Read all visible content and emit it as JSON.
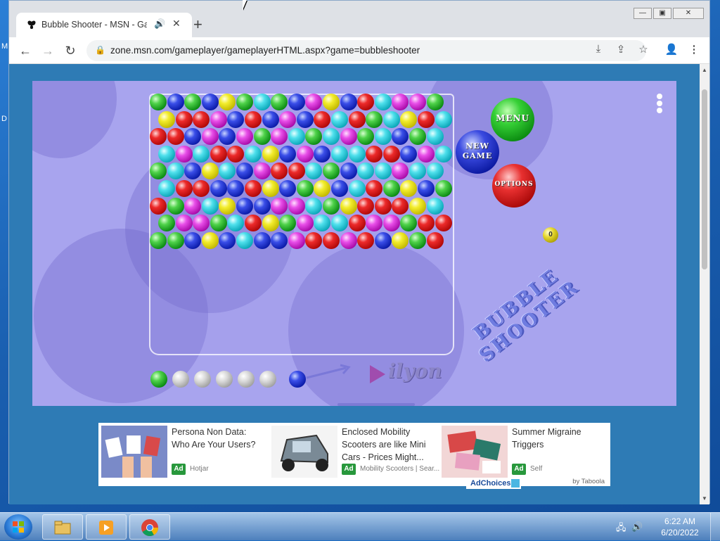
{
  "desktop": {
    "edge_letters": [
      "M",
      "D"
    ]
  },
  "browser": {
    "tab_title": "Bubble Shooter - MSN - Games",
    "url": "zone.msn.com/gameplayer/gameplayerHTML.aspx?game=bubbleshooter"
  },
  "game": {
    "menu_label": "MENU",
    "new_game_label": "NEW GAME",
    "options_label": "OPTIONS",
    "score": "0",
    "title_line1": "BUBBLE",
    "title_line2": "SHOOTER",
    "brand": "ilyon",
    "rows": [
      [
        "green",
        "blue",
        "green",
        "blue",
        "yellow",
        "green",
        "cyan",
        "green",
        "blue",
        "magenta",
        "yellow",
        "blue",
        "red",
        "cyan",
        "magenta",
        "magenta",
        "green"
      ],
      [
        "yellow",
        "red",
        "red",
        "magenta",
        "blue",
        "red",
        "blue",
        "magenta",
        "blue",
        "red",
        "cyan",
        "red",
        "green",
        "cyan",
        "yellow",
        "red",
        "cyan"
      ],
      [
        "red",
        "red",
        "blue",
        "magenta",
        "blue",
        "magenta",
        "green",
        "magenta",
        "cyan",
        "green",
        "cyan",
        "magenta",
        "green",
        "cyan",
        "blue",
        "green",
        "cyan"
      ],
      [
        "cyan",
        "magenta",
        "cyan",
        "red",
        "red",
        "cyan",
        "yellow",
        "blue",
        "magenta",
        "blue",
        "cyan",
        "cyan",
        "red",
        "red",
        "blue",
        "magenta",
        "cyan"
      ],
      [
        "green",
        "cyan",
        "blue",
        "yellow",
        "cyan",
        "blue",
        "magenta",
        "red",
        "red",
        "cyan",
        "green",
        "blue",
        "cyan",
        "cyan",
        "magenta",
        "cyan",
        "cyan"
      ],
      [
        "cyan",
        "red",
        "red",
        "blue",
        "blue",
        "red",
        "yellow",
        "blue",
        "green",
        "yellow",
        "blue",
        "cyan",
        "red",
        "green",
        "yellow",
        "blue",
        "green"
      ],
      [
        "red",
        "green",
        "magenta",
        "cyan",
        "yellow",
        "blue",
        "blue",
        "magenta",
        "magenta",
        "cyan",
        "green",
        "yellow",
        "red",
        "red",
        "red",
        "yellow",
        "cyan"
      ],
      [
        "green",
        "magenta",
        "magenta",
        "green",
        "cyan",
        "red",
        "yellow",
        "green",
        "magenta",
        "cyan",
        "cyan",
        "red",
        "magenta",
        "magenta",
        "green",
        "red",
        "red"
      ],
      [
        "green",
        "green",
        "blue",
        "yellow",
        "blue",
        "cyan",
        "blue",
        "blue",
        "magenta",
        "red",
        "red",
        "magenta",
        "red",
        "blue",
        "yellow",
        "green",
        "red"
      ]
    ],
    "queue": [
      "green",
      "grey",
      "grey",
      "grey",
      "grey",
      "grey"
    ],
    "current_bubble": "blue"
  },
  "ads": [
    {
      "title": "Persona Non Data: Who Are Your Users?",
      "badge": "Ad",
      "source": "Hotjar"
    },
    {
      "title": "Enclosed Mobility Scooters are like Mini Cars - Prices Might...",
      "badge": "Ad",
      "source": "Mobility Scooters | Sear..."
    },
    {
      "title": "Summer Migraine Triggers",
      "badge": "Ad",
      "source": "Self"
    }
  ],
  "taboola": "by Taboola",
  "adchoices": "AdChoices",
  "taskbar": {
    "time": "6:22 AM",
    "date": "6/20/2022"
  },
  "colors": {
    "green": "#0a8a12",
    "blue": "#0a1aa8",
    "yellow": "#c2b800",
    "cyan": "#0aa6b8",
    "magenta": "#a80aa8",
    "red": "#b00808",
    "grey": "#9a9a9a",
    "game_bg": "#a8a4ee",
    "page_bg": "#2e7bb5"
  }
}
